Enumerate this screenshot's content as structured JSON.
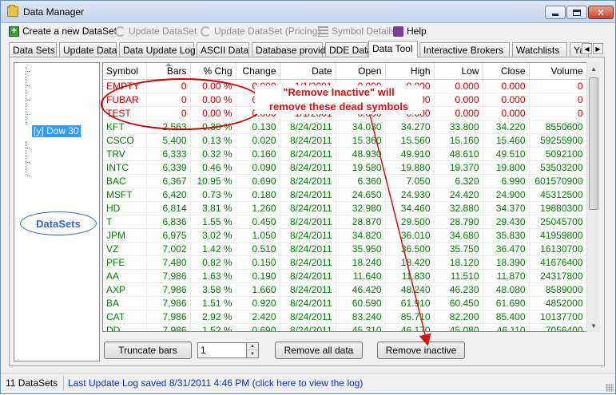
{
  "window": {
    "title": "Data Manager"
  },
  "toolbar": {
    "create": "Create a new DataSet",
    "update": "Update DataSet",
    "update_pricing": "Update DataSet (Pricing)",
    "symbol_details": "Symbol Details",
    "help": "Help"
  },
  "tabs": [
    "Data Sets",
    "Update Data",
    "Data Update Log",
    "ASCII Data",
    "Database provider",
    "DDE Data",
    "Data Tool",
    "Interactive Brokers",
    "Watchlists",
    "Yahoo! D"
  ],
  "active_tab": "Data Tool",
  "tree": {
    "selected_node": "[y] Dow 30",
    "annotation": "DataSets"
  },
  "grid": {
    "columns": [
      "Symbol",
      "Bars",
      "% Chg",
      "Change",
      "Date",
      "Open",
      "High",
      "Low",
      "Close",
      "Volume"
    ],
    "sorted_column": "Bars",
    "rows": [
      {
        "status": "dead",
        "cells": [
          "EMPTY",
          "0",
          "0.00 %",
          "0.000",
          "1/1/2001",
          "0.000",
          "0.000",
          "0.000",
          "0.000",
          "0"
        ]
      },
      {
        "status": "dead",
        "cells": [
          "FUBAR",
          "0",
          "0.00 %",
          "0.000",
          "1/1/2001",
          "0.000",
          "0.000",
          "0.000",
          "0.000",
          "0"
        ]
      },
      {
        "status": "dead",
        "cells": [
          "TEST",
          "0",
          "0.00 %",
          "0.000",
          "1/1/2001",
          "0.000",
          "0.000",
          "0.000",
          "0.000",
          "0"
        ]
      },
      {
        "status": "live",
        "cells": [
          "KFT",
          "2,563",
          "0.38 %",
          "0.130",
          "8/24/2011",
          "34.030",
          "34.270",
          "33.800",
          "34.220",
          "8550600"
        ]
      },
      {
        "status": "live",
        "cells": [
          "CSCO",
          "5,400",
          "0.13 %",
          "0.020",
          "8/24/2011",
          "15.360",
          "15.560",
          "15.160",
          "15.460",
          "59255900"
        ]
      },
      {
        "status": "live",
        "cells": [
          "TRV",
          "6,333",
          "0.32 %",
          "0.160",
          "8/24/2011",
          "48.930",
          "49.910",
          "48.610",
          "49.510",
          "5092100"
        ]
      },
      {
        "status": "live",
        "cells": [
          "INTC",
          "6,339",
          "0.46 %",
          "0.090",
          "8/24/2011",
          "19.580",
          "19.880",
          "19.370",
          "19.800",
          "53503200"
        ]
      },
      {
        "status": "live",
        "cells": [
          "BAC",
          "6,367",
          "10.95 %",
          "0.690",
          "8/24/2011",
          "6.360",
          "7.050",
          "6.320",
          "6.990",
          "601570900"
        ]
      },
      {
        "status": "live",
        "cells": [
          "MSFT",
          "6,420",
          "0.73 %",
          "0.180",
          "8/24/2011",
          "24.650",
          "24.930",
          "24.420",
          "24.900",
          "45312500"
        ]
      },
      {
        "status": "live",
        "cells": [
          "HD",
          "6,814",
          "3.81 %",
          "1.260",
          "8/24/2011",
          "32.980",
          "34.460",
          "32.880",
          "34.370",
          "19880300"
        ]
      },
      {
        "status": "live",
        "cells": [
          "T",
          "6,836",
          "1.55 %",
          "0.450",
          "8/24/2011",
          "28.870",
          "29.500",
          "28.790",
          "29.430",
          "25045700"
        ]
      },
      {
        "status": "live",
        "cells": [
          "JPM",
          "6,975",
          "3.02 %",
          "1.050",
          "8/24/2011",
          "34.820",
          "36.010",
          "34.680",
          "35.830",
          "41959800"
        ]
      },
      {
        "status": "live",
        "cells": [
          "VZ",
          "7,002",
          "1.42 %",
          "0.510",
          "8/24/2011",
          "35.950",
          "36.500",
          "35.750",
          "36.470",
          "16130700"
        ]
      },
      {
        "status": "live",
        "cells": [
          "PFE",
          "7,480",
          "0.82 %",
          "0.150",
          "8/24/2011",
          "18.240",
          "18.420",
          "18.120",
          "18.390",
          "41676400"
        ]
      },
      {
        "status": "live",
        "cells": [
          "AA",
          "7,986",
          "1.63 %",
          "0.190",
          "8/24/2011",
          "11.640",
          "11.830",
          "11.510",
          "11.870",
          "24317800"
        ]
      },
      {
        "status": "live",
        "cells": [
          "AXP",
          "7,986",
          "3.58 %",
          "1.660",
          "8/24/2011",
          "46.420",
          "48.240",
          "46.230",
          "48.080",
          "8589000"
        ]
      },
      {
        "status": "live",
        "cells": [
          "BA",
          "7,986",
          "1.51 %",
          "0.920",
          "8/24/2011",
          "60.590",
          "61.910",
          "60.450",
          "61.690",
          "4852000"
        ]
      },
      {
        "status": "live",
        "cells": [
          "CAT",
          "7,986",
          "2.92 %",
          "2.420",
          "8/24/2011",
          "83.240",
          "85.710",
          "82.200",
          "85.400",
          "10137700"
        ]
      },
      {
        "status": "live",
        "cells": [
          "DD",
          "7,986",
          "1.52 %",
          "0.690",
          "8/24/2011",
          "45.310",
          "46.170",
          "45.080",
          "46.110",
          "7056400"
        ]
      }
    ]
  },
  "controls": {
    "truncate_bars": "Truncate bars",
    "spin_value": "1",
    "remove_all": "Remove all data",
    "remove_inactive": "Remove inactive"
  },
  "annotation": {
    "line1": "\"Remove Inactive\" will",
    "line2": "remove these dead symbols"
  },
  "status": {
    "count": "11 DataSets",
    "log": "Last Update Log saved 8/31/2011 4:46 PM (click here to view the log)"
  },
  "colors": {
    "dead_row": "#cc0000",
    "live_row": "#008000",
    "annotation_red": "#e01010",
    "annotation_blue": "#3366cc",
    "selection": "#3399ff"
  }
}
